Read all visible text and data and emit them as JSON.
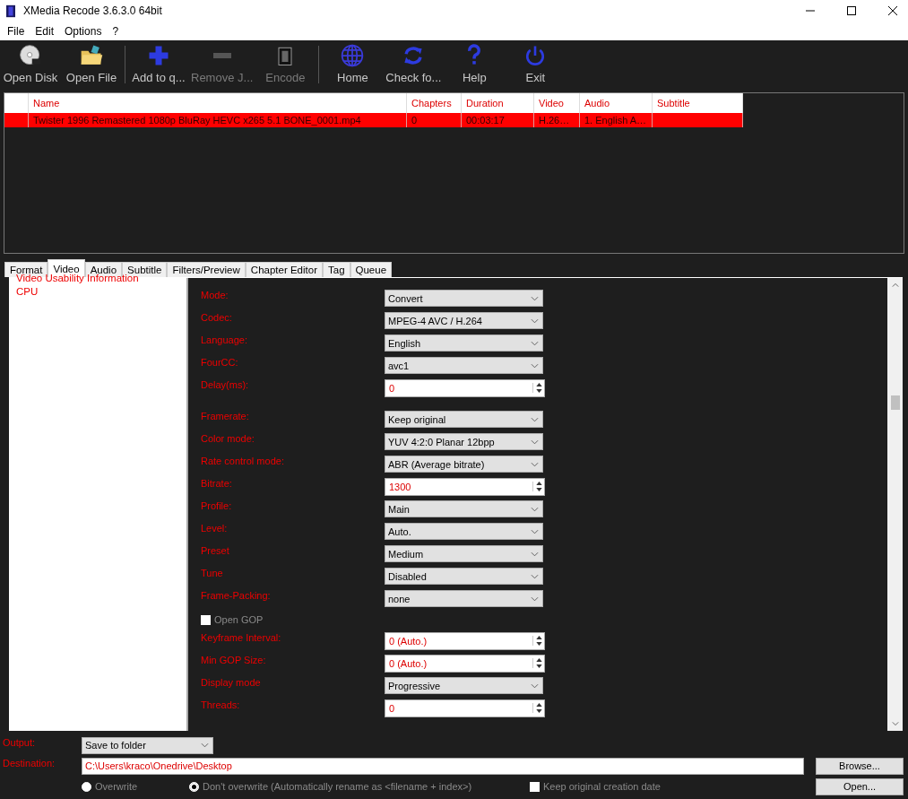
{
  "window": {
    "title": "XMedia Recode 3.6.3.0 64bit"
  },
  "menu": [
    "File",
    "Edit",
    "Options",
    "?"
  ],
  "toolbar": [
    {
      "kind": "disc",
      "label": "Open Disk",
      "disabled": false,
      "separator_before": false
    },
    {
      "kind": "folder",
      "label": "Open File",
      "disabled": false,
      "separator_before": false
    },
    {
      "kind": "plus",
      "label": "Add to q...",
      "disabled": false,
      "separator_before": true
    },
    {
      "kind": "minus",
      "label": "Remove J...",
      "disabled": true,
      "separator_before": false
    },
    {
      "kind": "film",
      "label": "Encode",
      "disabled": true,
      "separator_before": false
    },
    {
      "kind": "globe",
      "label": "Home",
      "disabled": false,
      "separator_before": true
    },
    {
      "kind": "refresh",
      "label": "Check fo...",
      "disabled": false,
      "separator_before": false
    },
    {
      "kind": "help",
      "label": "Help",
      "disabled": false,
      "separator_before": false
    },
    {
      "kind": "power",
      "label": "Exit",
      "disabled": false,
      "separator_before": false
    }
  ],
  "table": {
    "columns": [
      "Name",
      "Chapters",
      "Duration",
      "Video",
      "Audio",
      "Subtitle"
    ],
    "rows": [
      {
        "selected": true,
        "cells": [
          "Twister 1996 Remastered 1080p BluRay HEVC x265 5.1 BONE_0001.mp4",
          "0",
          "00:03:17",
          "H.26…",
          "1. English A…",
          ""
        ]
      }
    ]
  },
  "tabs": [
    {
      "label": "Format",
      "selected": false
    },
    {
      "label": "Video",
      "selected": true
    },
    {
      "label": "Audio",
      "selected": false
    },
    {
      "label": "Subtitle",
      "selected": false
    },
    {
      "label": "Filters/Preview",
      "selected": false
    },
    {
      "label": "Chapter Editor",
      "selected": false
    },
    {
      "label": "Tag",
      "selected": false
    },
    {
      "label": "Queue",
      "selected": false
    }
  ],
  "sidebar": {
    "items": [
      "Video Usability Information",
      "CPU"
    ]
  },
  "settings": [
    {
      "kind": "select",
      "label": "Mode:",
      "value": "Convert"
    },
    {
      "kind": "select",
      "label": "Codec:",
      "value": "MPEG-4 AVC / H.264"
    },
    {
      "kind": "select",
      "label": "Language:",
      "value": "English"
    },
    {
      "kind": "select",
      "label": "FourCC:",
      "value": "avc1"
    },
    {
      "kind": "spin",
      "label": "Delay(ms):",
      "value": "0"
    },
    {
      "kind": "select",
      "label": "Framerate:",
      "value": "Keep original",
      "group_start": true
    },
    {
      "kind": "select",
      "label": "Color mode:",
      "value": "YUV 4:2:0 Planar 12bpp"
    },
    {
      "kind": "select",
      "label": "Rate control mode:",
      "value": "ABR (Average bitrate)"
    },
    {
      "kind": "spin",
      "label": "Bitrate:",
      "value": "1300"
    },
    {
      "kind": "select",
      "label": "Profile:",
      "value": "Main"
    },
    {
      "kind": "select",
      "label": "Level:",
      "value": "Auto."
    },
    {
      "kind": "select",
      "label": "Preset",
      "value": "Medium"
    },
    {
      "kind": "select",
      "label": "Tune",
      "value": "Disabled"
    },
    {
      "kind": "select",
      "label": "Frame-Packing:",
      "value": "none"
    },
    {
      "kind": "checkbox",
      "label": "Open GOP",
      "checked": false
    },
    {
      "kind": "spin",
      "label": "Keyframe Interval:",
      "value": "0 (Auto.)"
    },
    {
      "kind": "spin",
      "label": "Min GOP Size:",
      "value": "0 (Auto.)"
    },
    {
      "kind": "select",
      "label": "Display mode",
      "value": "Progressive"
    },
    {
      "kind": "spin",
      "label": "Threads:",
      "value": "0"
    }
  ],
  "output": {
    "label": "Output:",
    "value": "Save to folder"
  },
  "destination": {
    "label": "Destination:",
    "value": "C:\\Users\\kraco\\Onedrive\\Desktop",
    "browse": "Browse...",
    "open": "Open..."
  },
  "overwrite_options": [
    {
      "label": "Overwrite",
      "selected": false
    },
    {
      "label": "Don't overwrite (Automatically rename as <filename + index>)",
      "selected": true
    }
  ],
  "keep_date": {
    "label": "Keep original creation date",
    "checked": false
  }
}
